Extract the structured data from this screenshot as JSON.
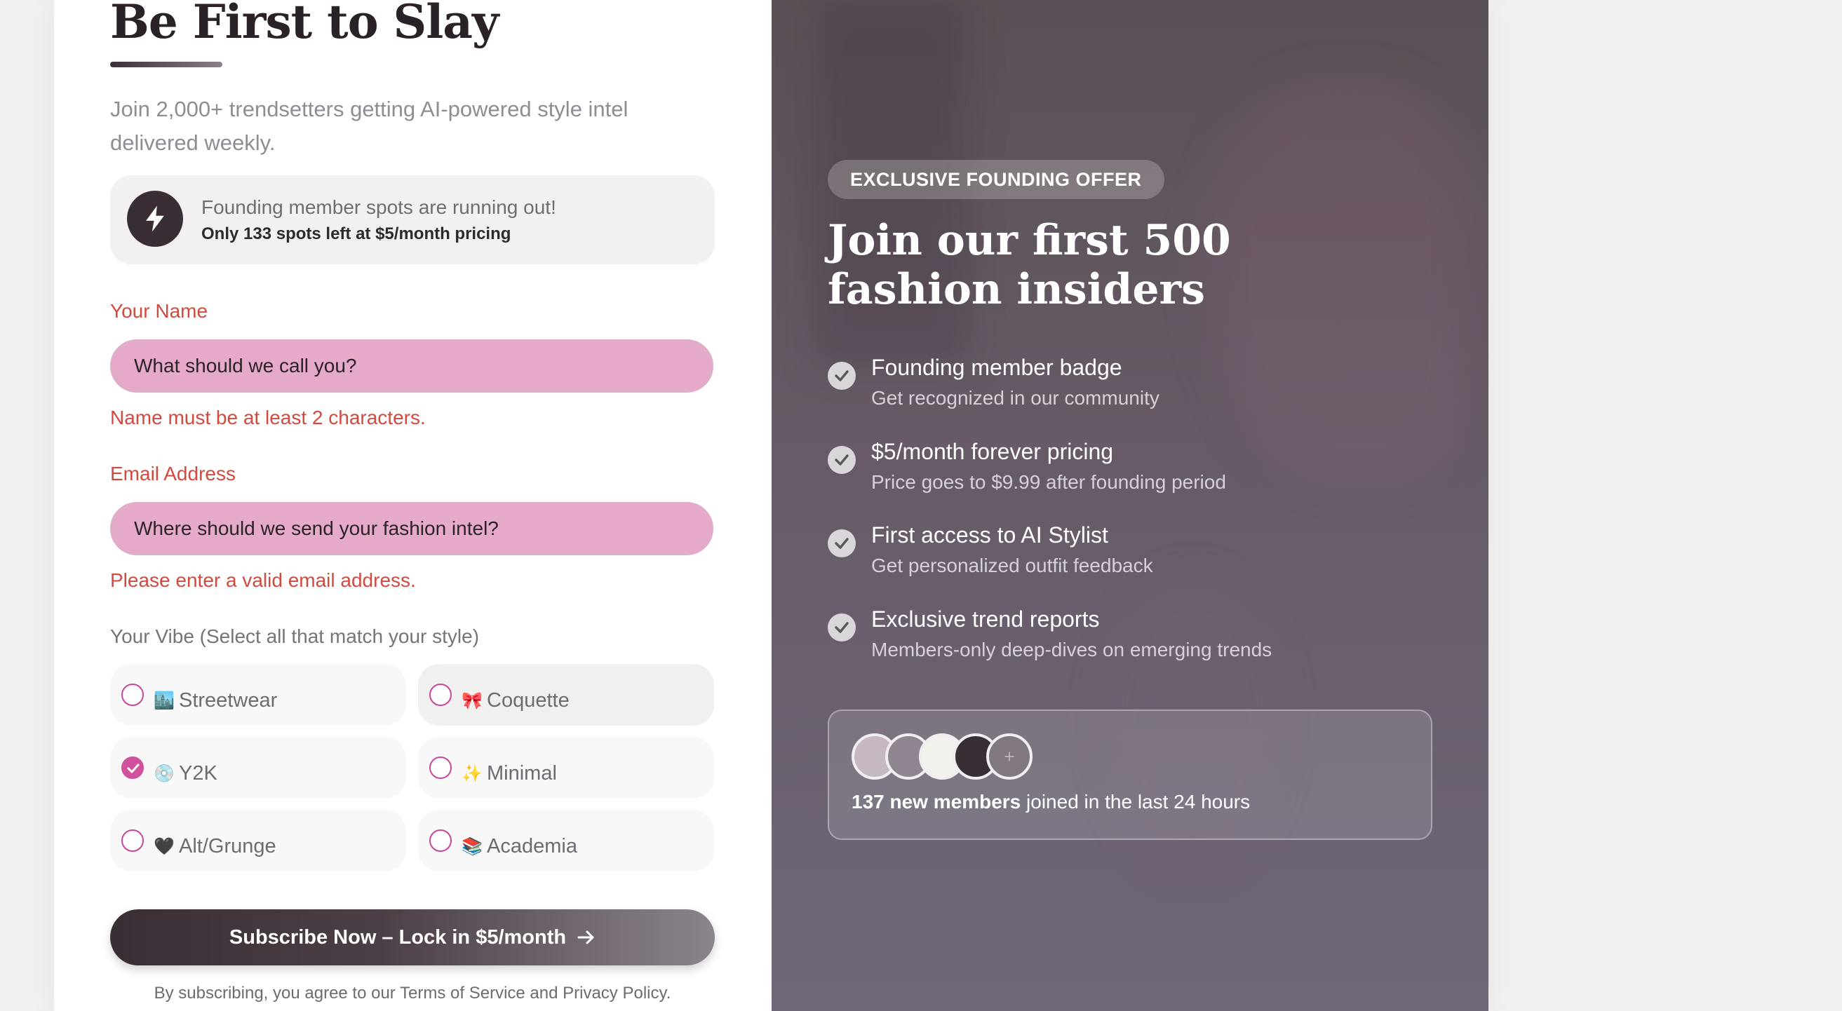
{
  "signup": {
    "title": "Be First to Slay",
    "subtitle": "Join 2,000+ trendsetters getting AI-powered style intel delivered weekly.",
    "alert": {
      "line1": "Founding member spots are running out!",
      "line2": "Only 133 spots left at $5/month pricing"
    },
    "name": {
      "label": "Your Name",
      "placeholder": "What should we call you?",
      "value": "",
      "error": "Name must be at least 2 characters."
    },
    "email": {
      "label": "Email Address",
      "placeholder": "Where should we send your fashion intel?",
      "value": "",
      "error": "Please enter a valid email address."
    },
    "vibe": {
      "label": "Your Vibe (Select all that match your style)",
      "options": [
        {
          "emoji": "🏙️",
          "label": "Streetwear",
          "checked": false
        },
        {
          "emoji": "🎀",
          "label": "Coquette",
          "checked": false
        },
        {
          "emoji": "💿",
          "label": "Y2K",
          "checked": true
        },
        {
          "emoji": "✨",
          "label": "Minimal",
          "checked": false
        },
        {
          "emoji": "🖤",
          "label": "Alt/Grunge",
          "checked": false
        },
        {
          "emoji": "📚",
          "label": "Academia",
          "checked": false
        }
      ]
    },
    "cta": "Subscribe Now – Lock in $5/month",
    "terms": "By subscribing, you agree to our Terms of Service and Privacy Policy."
  },
  "offer": {
    "badge": "EXCLUSIVE FOUNDING OFFER",
    "headline": "Join our first 500 fashion insiders",
    "benefits": [
      {
        "title": "Founding member badge",
        "desc": "Get recognized in our community"
      },
      {
        "title": "$5/month forever pricing",
        "desc": "Price goes to $9.99 after founding period"
      },
      {
        "title": "First access to AI Stylist",
        "desc": "Get personalized outfit feedback"
      },
      {
        "title": "Exclusive trend reports",
        "desc": "Members-only deep-dives on emerging trends"
      }
    ],
    "members": {
      "count_text": "137 new members",
      "rest_text": " joined in the last 24 hours",
      "plus": "+",
      "avatar_colors": [
        "#c5b8c3",
        "#8e8590",
        "#f3f1ec",
        "#3a2e36"
      ]
    }
  },
  "colors": {
    "error": "#d24a3e",
    "input_fill": "#e5a9c9",
    "accent": "#d0519d",
    "dark": "#3a2e36"
  }
}
